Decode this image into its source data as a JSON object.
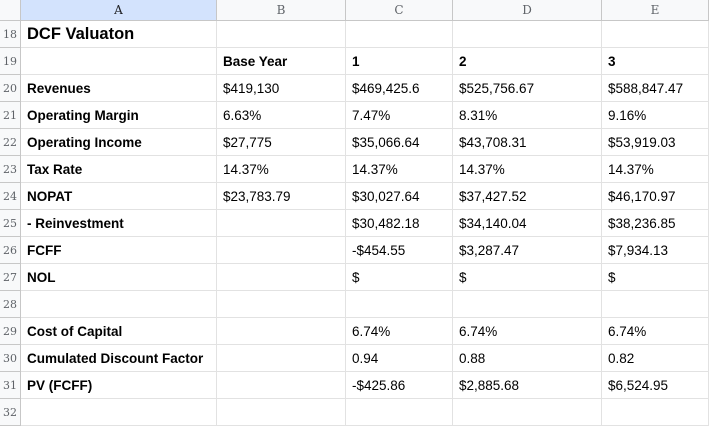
{
  "columns": [
    "A",
    "B",
    "C",
    "D",
    "E"
  ],
  "rows": [
    {
      "num": "18",
      "cells": [
        "DCF Valuaton",
        "",
        "",
        "",
        ""
      ]
    },
    {
      "num": "19",
      "cells": [
        "",
        "Base Year",
        "1",
        "2",
        "3"
      ]
    },
    {
      "num": "20",
      "cells": [
        "Revenues",
        "$419,130",
        "$469,425.6",
        "$525,756.67",
        "$588,847.47"
      ]
    },
    {
      "num": "21",
      "cells": [
        "Operating Margin",
        "6.63%",
        "7.47%",
        "8.31%",
        "9.16%"
      ]
    },
    {
      "num": "22",
      "cells": [
        "Operating Income",
        "$27,775",
        "$35,066.64",
        "$43,708.31",
        "$53,919.03"
      ]
    },
    {
      "num": "23",
      "cells": [
        "Tax Rate",
        "14.37%",
        "14.37%",
        "14.37%",
        "14.37%"
      ]
    },
    {
      "num": "24",
      "cells": [
        "NOPAT",
        "$23,783.79",
        "$30,027.64",
        "$37,427.52",
        "$46,170.97"
      ]
    },
    {
      "num": "25",
      "cells": [
        "- Reinvestment",
        "",
        "$30,482.18",
        "$34,140.04",
        "$38,236.85"
      ]
    },
    {
      "num": "26",
      "cells": [
        "FCFF",
        "",
        "-$454.55",
        "$3,287.47",
        "$7,934.13"
      ]
    },
    {
      "num": "27",
      "cells": [
        "NOL",
        "",
        "$",
        "$",
        "$"
      ]
    },
    {
      "num": "28",
      "cells": [
        "",
        "",
        "",
        "",
        ""
      ]
    },
    {
      "num": "29",
      "cells": [
        "Cost of Capital",
        "",
        "6.74%",
        "6.74%",
        "6.74%"
      ]
    },
    {
      "num": "30",
      "cells": [
        "Cumulated Discount Factor",
        "",
        "0.94",
        "0.88",
        "0.82"
      ]
    },
    {
      "num": "31",
      "cells": [
        "PV (FCFF)",
        "",
        "-$425.86",
        "$2,885.68",
        "$6,524.95"
      ]
    },
    {
      "num": "32",
      "cells": [
        "",
        "",
        "",
        "",
        ""
      ]
    }
  ]
}
